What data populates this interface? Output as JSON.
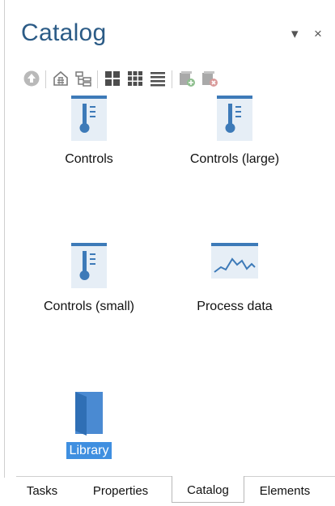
{
  "header": {
    "title": "Catalog",
    "dropdown_glyph": "▾",
    "close_glyph": "×"
  },
  "toolbar": {
    "icons": [
      "up-arrow-icon",
      "home-icon",
      "tree-icon",
      "large-icons-view-icon",
      "small-icons-view-icon",
      "list-view-icon",
      "add-item-icon",
      "remove-item-icon"
    ]
  },
  "items": [
    {
      "label": "Controls",
      "icon": "thermometer-icon"
    },
    {
      "label": "Controls (large)",
      "icon": "thermometer-icon"
    },
    {
      "label": "Controls (small)",
      "icon": "thermometer-icon"
    },
    {
      "label": "Process data",
      "icon": "trend-line-icon"
    },
    {
      "label": "Library",
      "icon": "folder-icon",
      "selected": true
    }
  ],
  "tabs": [
    {
      "label": "Tasks"
    },
    {
      "label": "Properties"
    },
    {
      "label": "Catalog",
      "active": true
    },
    {
      "label": "Elements"
    }
  ],
  "colors": {
    "title": "#2b5b86",
    "icon_blue": "#3d7ab8",
    "selection": "#3f8fe0"
  }
}
